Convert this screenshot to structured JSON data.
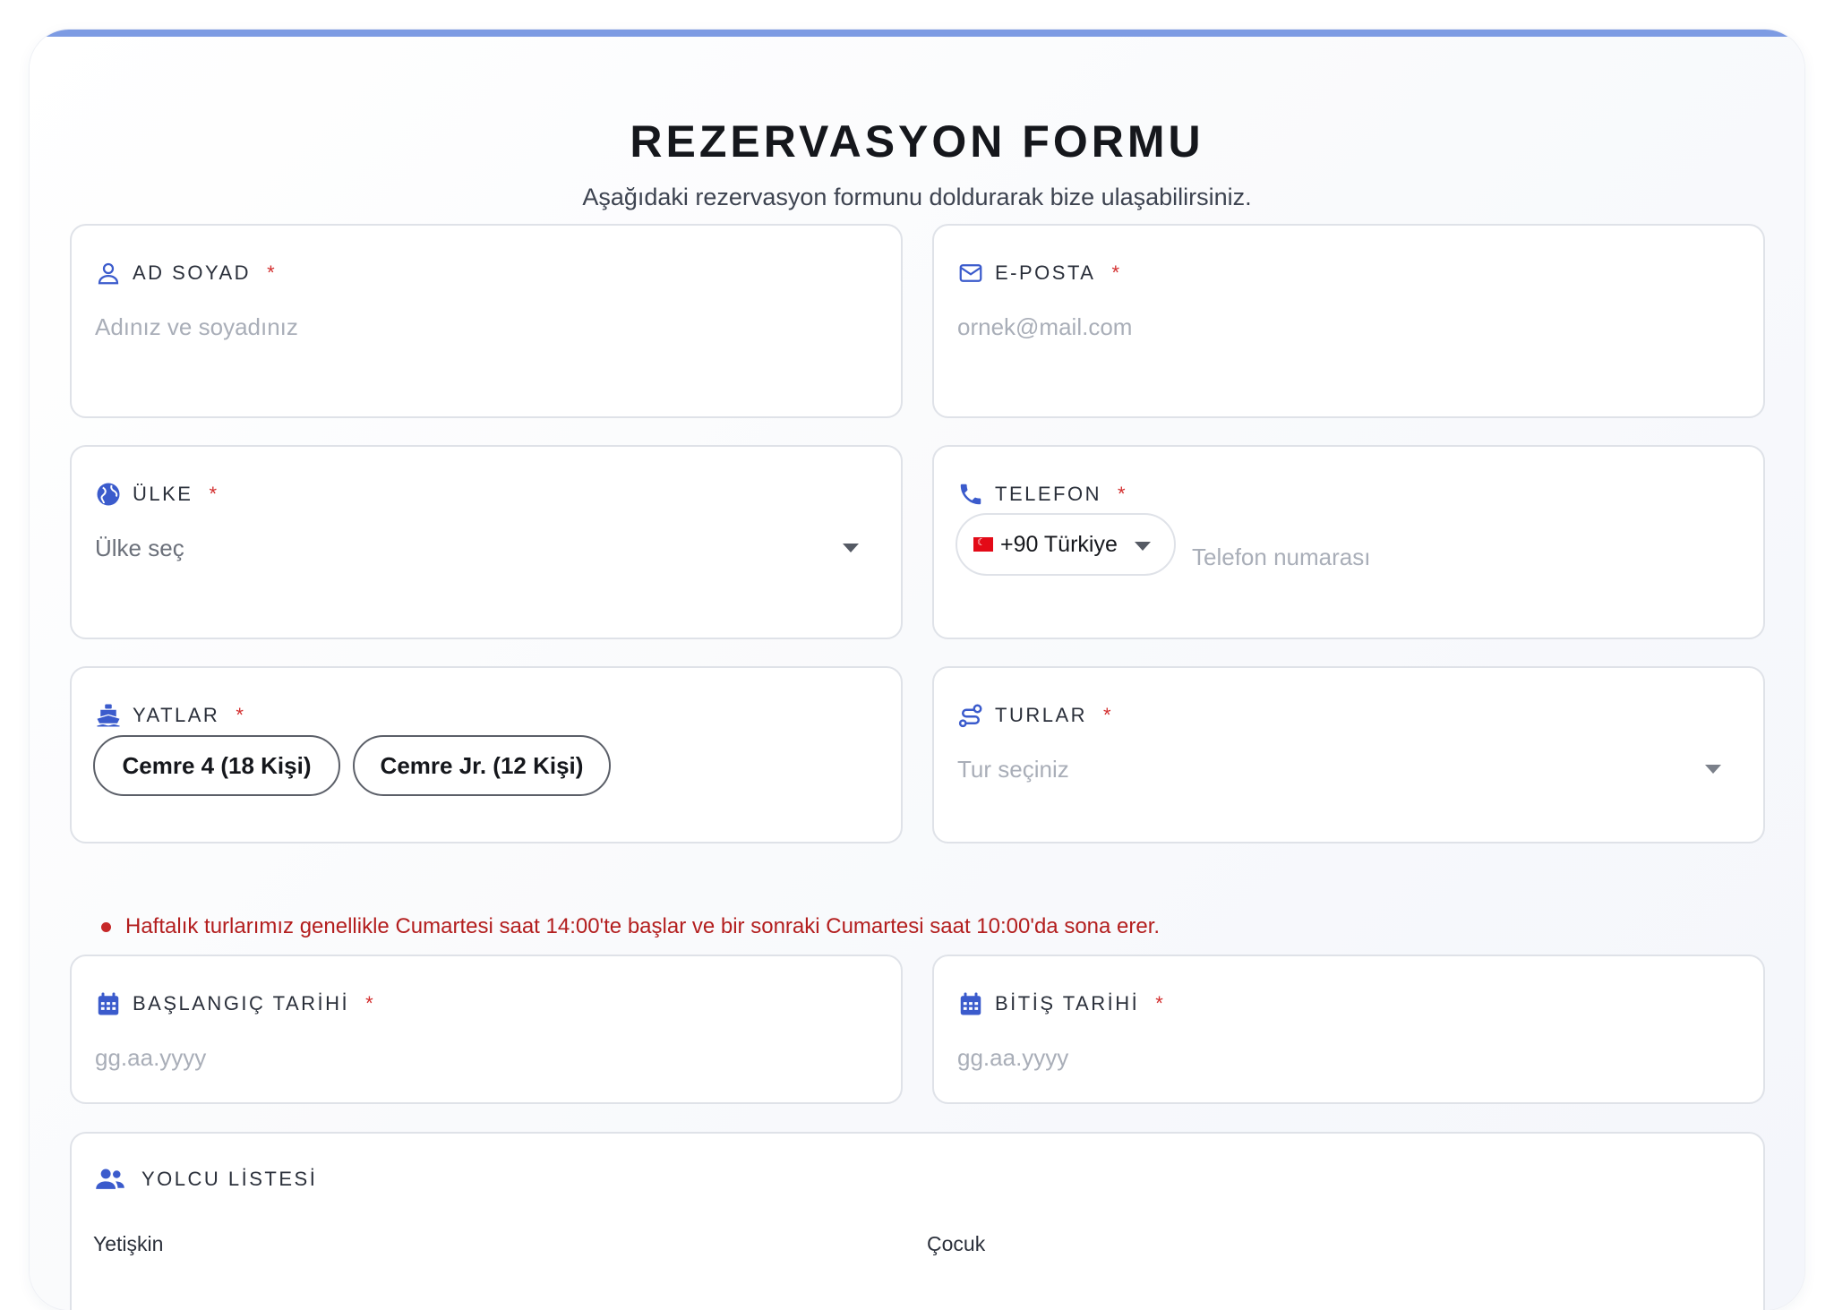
{
  "form": {
    "title": "REZERVASYON FORMU",
    "subtitle": "Aşağıdaki rezervasyon formunu doldurarak bize ulaşabilirsiniz.",
    "required_mark": "*"
  },
  "fields": {
    "name": {
      "label": "AD SOYAD",
      "placeholder": "Adınız ve soyadınız",
      "icon": "user-icon"
    },
    "email": {
      "label": "E-POSTA",
      "placeholder": "ornek@mail.com",
      "icon": "envelope-icon"
    },
    "country": {
      "label": "ÜLKE",
      "placeholder": "Ülke seç",
      "icon": "globe-icon"
    },
    "phone": {
      "label": "TELEFON",
      "country_code": "+90 Türkiye",
      "placeholder": "Telefon numarası",
      "icon": "phone-icon"
    },
    "yachts": {
      "label": "YATLAR",
      "options": [
        "Cemre 4 (18 Kişi)",
        "Cemre Jr. (12 Kişi)"
      ],
      "icon": "ship-icon"
    },
    "tours": {
      "label": "TURLAR",
      "placeholder": "Tur seçiniz",
      "icon": "route-icon"
    },
    "start_date": {
      "label": "BAŞLANGIÇ TARİHİ",
      "placeholder": "gg.aa.yyyy",
      "icon": "calendar-icon"
    },
    "end_date": {
      "label": "BİTİŞ TARİHİ",
      "placeholder": "gg.aa.yyyy",
      "icon": "calendar-icon"
    },
    "passengers": {
      "label": "YOLCU LİSTESİ",
      "adult_label": "Yetişkin",
      "child_label": "Çocuk",
      "icon": "users-icon"
    }
  },
  "note": "Haftalık turlarımız genellikle Cumartesi saat 14:00'te başlar ve bir sonraki Cumartesi saat 10:00'da sona erer.",
  "colors": {
    "accent": "#3b5bcc",
    "required": "#d32f2f",
    "topline": "#7d9be3",
    "note": "#b31e1e"
  }
}
